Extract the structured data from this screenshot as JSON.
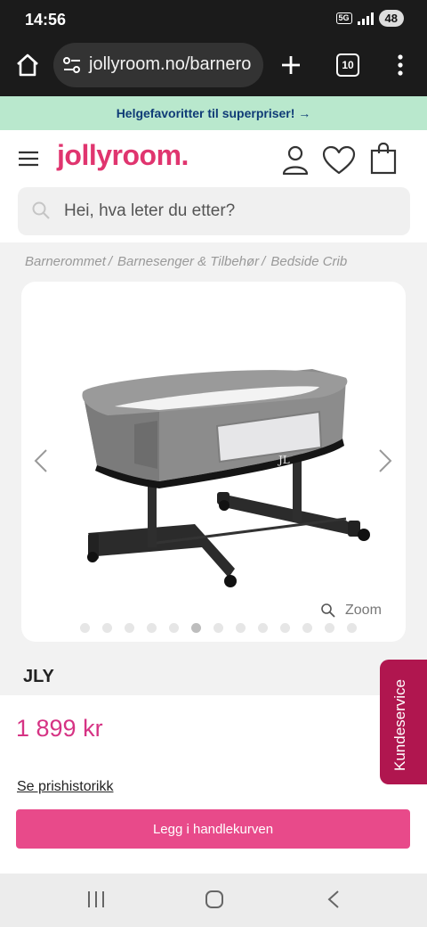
{
  "status_bar": {
    "time": "14:56",
    "network": "5G",
    "battery": "48"
  },
  "browser": {
    "url": "jollyroom.no/barnero",
    "tab_count": "10"
  },
  "promo": {
    "text": "Helgefavoritter til superpriser! →"
  },
  "header": {
    "logo": "jollyroom.",
    "search_placeholder": "Hei, hva leter du etter?"
  },
  "breadcrumb": [
    {
      "label": "Barnerommet",
      "sep": "/"
    },
    {
      "label": "Barnesenger & Tilbehør",
      "sep": "/"
    },
    {
      "label": "Bedside Crib",
      "sep": ""
    }
  ],
  "gallery": {
    "zoom_label": "Zoom",
    "total_images": 13,
    "active_index": 5
  },
  "product": {
    "brand": "JLY",
    "price": "1 899 kr",
    "price_history_label": "Se prishistorikk",
    "add_to_cart_label": "Legg i handlekurven"
  },
  "customer_service": {
    "label": "Kundeservice"
  },
  "colors": {
    "brand_pink": "#e0356f",
    "button_pink": "#e84a8a",
    "promo_green": "#b9e8cd",
    "cs_tab": "#b0164f"
  }
}
